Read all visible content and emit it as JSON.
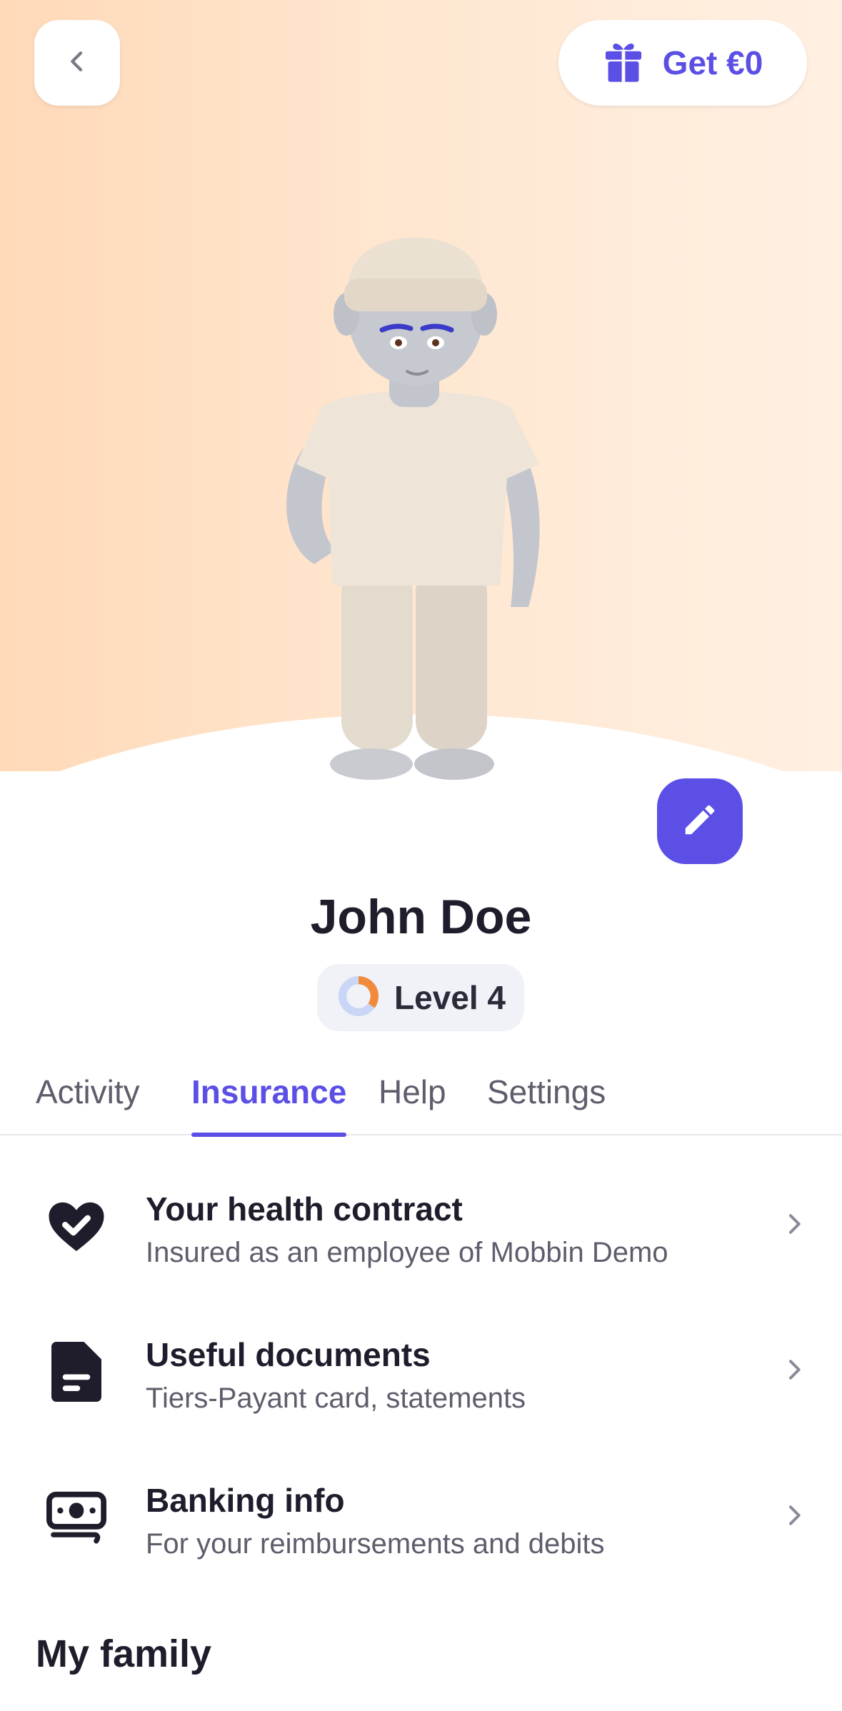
{
  "header": {
    "back_icon": "chevron-left-icon",
    "gift_icon": "gift-icon",
    "gift_label": "Get €0"
  },
  "avatar": {
    "icon": "3d-avatar-figure",
    "edit_icon": "pencil-icon"
  },
  "profile": {
    "name": "John Doe",
    "level_label": "Level 4",
    "level_progress": 0.35
  },
  "tabs": [
    {
      "label": "Activity",
      "active": false
    },
    {
      "label": "Insurance",
      "active": true
    },
    {
      "label": "Help",
      "active": false
    },
    {
      "label": "Settings",
      "active": false
    }
  ],
  "insurance_items": [
    {
      "icon": "heart-check-icon",
      "title": "Your health contract",
      "subtitle": "Insured as an employee of Mobbin Demo"
    },
    {
      "icon": "document-icon",
      "title": "Useful documents",
      "subtitle": "Tiers-Payant card, statements"
    },
    {
      "icon": "banknote-icon",
      "title": "Banking info",
      "subtitle": "For your reimbursements and debits"
    }
  ],
  "family": {
    "title": "My family"
  },
  "colors": {
    "accent": "#5b4fe6",
    "hero_start": "#ffd9b8",
    "hero_end": "#fff0e2",
    "level_ring": "#f28a3c"
  }
}
